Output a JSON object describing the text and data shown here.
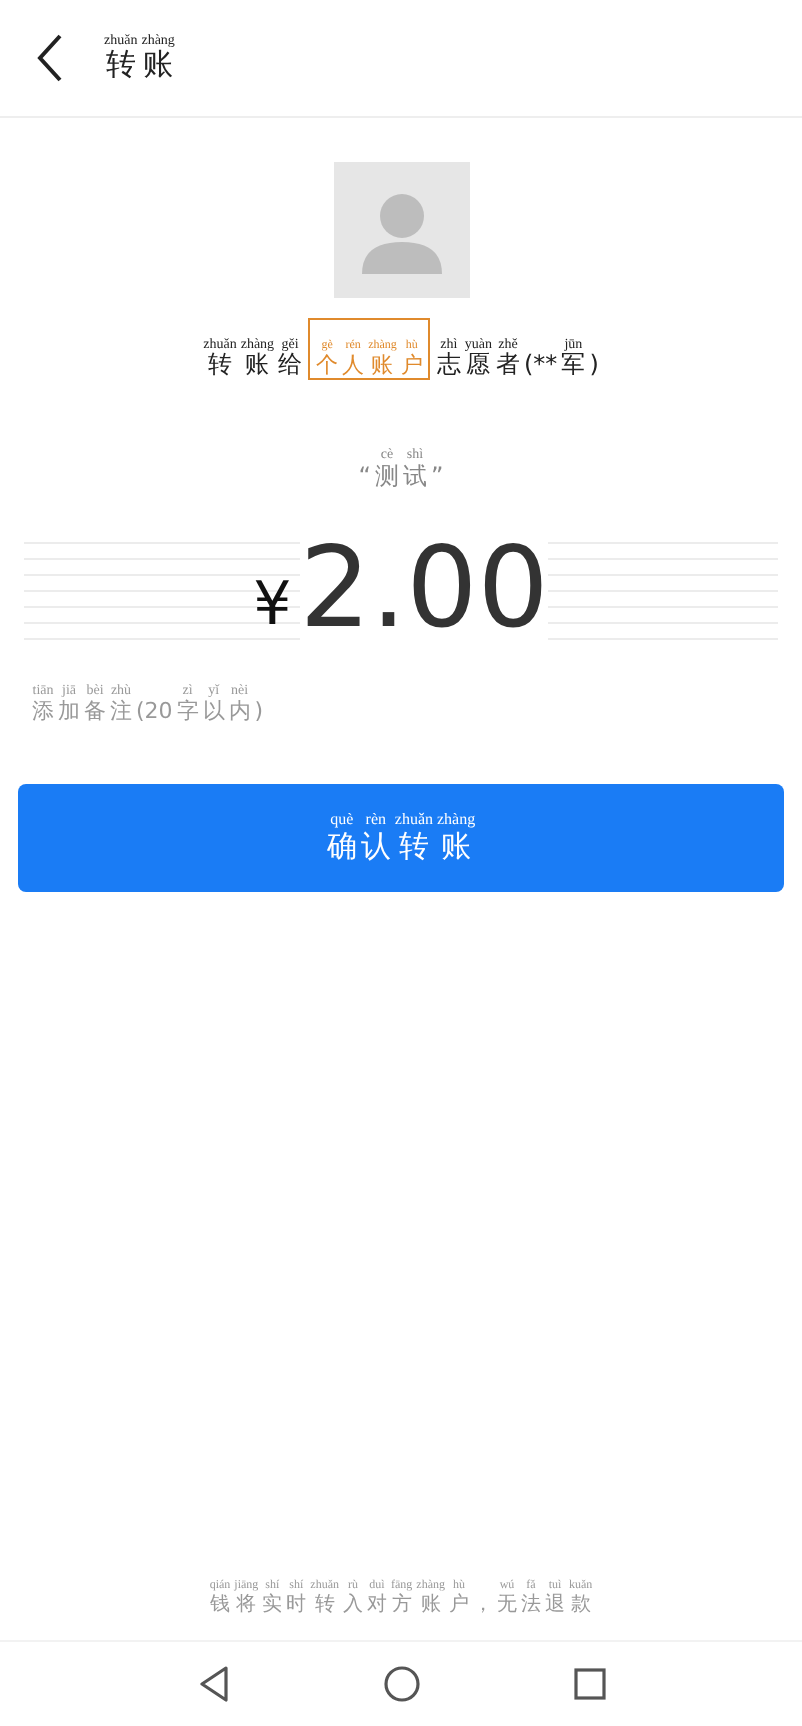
{
  "header": {
    "title": [
      [
        "zhuǎn",
        "转"
      ],
      [
        "zhàng",
        "账"
      ]
    ]
  },
  "recipient": {
    "prefix": [
      [
        "zhuǎn",
        "转"
      ],
      [
        "zhàng",
        "账"
      ],
      [
        "gěi",
        "给"
      ]
    ],
    "badge": [
      [
        "gè",
        "个"
      ],
      [
        "rén",
        "人"
      ],
      [
        "zhàng",
        "账"
      ],
      [
        "hù",
        "户"
      ]
    ],
    "name": [
      [
        "zhì",
        "志"
      ],
      [
        "yuàn",
        "愿"
      ],
      [
        "zhě",
        "者"
      ],
      [
        "(**"
      ],
      [
        "jūn",
        "军"
      ],
      [
        ")"
      ]
    ]
  },
  "note": [
    [
      "“ "
    ],
    [
      "cè",
      "测"
    ],
    [
      "shì",
      "试"
    ],
    [
      " ”"
    ]
  ],
  "amount": {
    "currency": "¥",
    "value": "2.00"
  },
  "remark": {
    "placeholder": [
      [
        "tiān",
        "添"
      ],
      [
        "jiā",
        "加"
      ],
      [
        "bèi",
        "备"
      ],
      [
        "zhù",
        "注"
      ],
      [
        "(20"
      ],
      [
        "zì",
        "字"
      ],
      [
        "yǐ",
        "以"
      ],
      [
        "nèi",
        "内"
      ],
      [
        ")"
      ]
    ]
  },
  "confirm_button": [
    [
      "què",
      "确"
    ],
    [
      "rèn",
      "认"
    ],
    [
      "zhuǎn",
      "转"
    ],
    [
      "zhàng",
      "账"
    ]
  ],
  "footer": [
    [
      "qián",
      "钱"
    ],
    [
      "jiāng",
      "将"
    ],
    [
      "shí",
      "实"
    ],
    [
      "shí",
      "时"
    ],
    [
      "zhuǎn",
      "转"
    ],
    [
      "rù",
      "入"
    ],
    [
      "duì",
      "对"
    ],
    [
      "fāng",
      "方"
    ],
    [
      "zhàng",
      "账"
    ],
    [
      "hù",
      "户"
    ],
    [
      " ，"
    ],
    [
      "wú",
      "无"
    ],
    [
      "fǎ",
      "法"
    ],
    [
      "tuì",
      "退"
    ],
    [
      "kuǎn",
      "款"
    ]
  ]
}
